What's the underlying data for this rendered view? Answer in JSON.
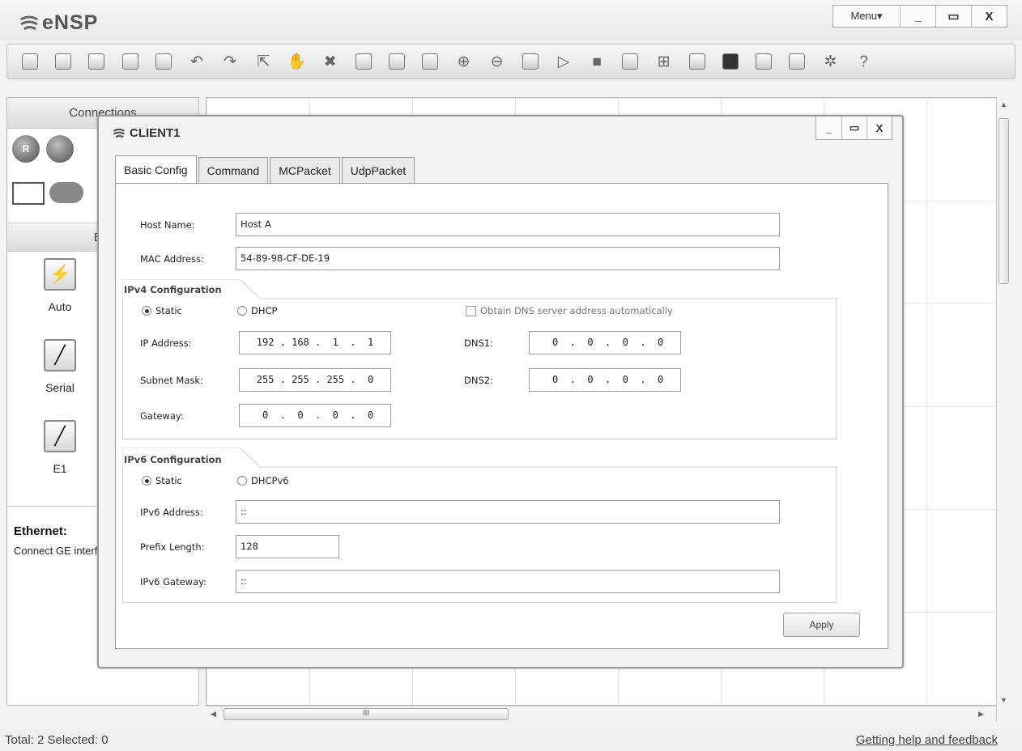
{
  "app": {
    "title": "eNSP"
  },
  "window_controls": {
    "menu": "Menu▾",
    "minimize": "_",
    "maximize": "▭",
    "close": "X"
  },
  "toolbar": {
    "buttons": [
      "new-topology-icon",
      "open-icon",
      "save-icon",
      "save-as-icon",
      "print-icon",
      "undo-icon",
      "redo-icon",
      "select-icon",
      "pan-icon",
      "delete-icon",
      "delete-link-icon",
      "text-icon",
      "rectangle-icon",
      "zoom-in-icon",
      "zoom-out-icon",
      "fit-icon",
      "start-icon",
      "stop-icon",
      "capture-icon",
      "topology-icon",
      "grid-icon",
      "screen-icon",
      "chat-icon",
      "huawei-icon",
      "settings-icon",
      "help-icon"
    ]
  },
  "left_panel": {
    "connections_header": "Connections",
    "router_label": "R",
    "ethernet_header": "Eth",
    "cables": [
      {
        "label": "Auto",
        "icon": "lightning-icon"
      },
      {
        "label": "Serial",
        "icon": "serial-cable-icon"
      },
      {
        "label": "E1",
        "icon": "e1-cable-icon"
      }
    ],
    "description": {
      "title": "Ethernet:",
      "text": "Connect GE interfaces of"
    }
  },
  "hscroll": {
    "thumb_label": "III"
  },
  "status": {
    "left": "Total: 2  Selected: 0",
    "right": "Getting help and feedback"
  },
  "dialog": {
    "title": "CLIENT1",
    "controls": {
      "minimize": "_",
      "maximize": "▭",
      "close": "X"
    },
    "tabs": [
      "Basic Config",
      "Command",
      "MCPacket",
      "UdpPacket"
    ],
    "active_tab": "Basic Config",
    "host_name": {
      "label": "Host Name:",
      "value": "Host A"
    },
    "mac_address": {
      "label": "MAC Address:",
      "value": "54-89-98-CF-DE-19"
    },
    "ipv4": {
      "title": "IPv4 Configuration",
      "static_label": "Static",
      "dhcp_label": "DHCP",
      "dns_auto_label": "Obtain DNS server address automatically",
      "ip_label": "IP Address:",
      "ip_value": "192 . 168 .  1  .  1",
      "mask_label": "Subnet Mask:",
      "mask_value": "255 . 255 . 255 .  0",
      "gateway_label": "Gateway:",
      "gateway_value": " 0  .  0  .  0  .  0",
      "dns1_label": "DNS1:",
      "dns1_value": " 0  .  0  .  0  .  0",
      "dns2_label": "DNS2:",
      "dns2_value": " 0  .  0  .  0  .  0"
    },
    "ipv6": {
      "title": "IPv6 Configuration",
      "static_label": "Static",
      "dhcp_label": "DHCPv6",
      "address_label": "IPv6 Address:",
      "address_value": "::",
      "prefix_label": "Prefix Length:",
      "prefix_value": "128",
      "gateway_label": "IPv6 Gateway:",
      "gateway_value": "::"
    },
    "apply_label": "Apply"
  }
}
